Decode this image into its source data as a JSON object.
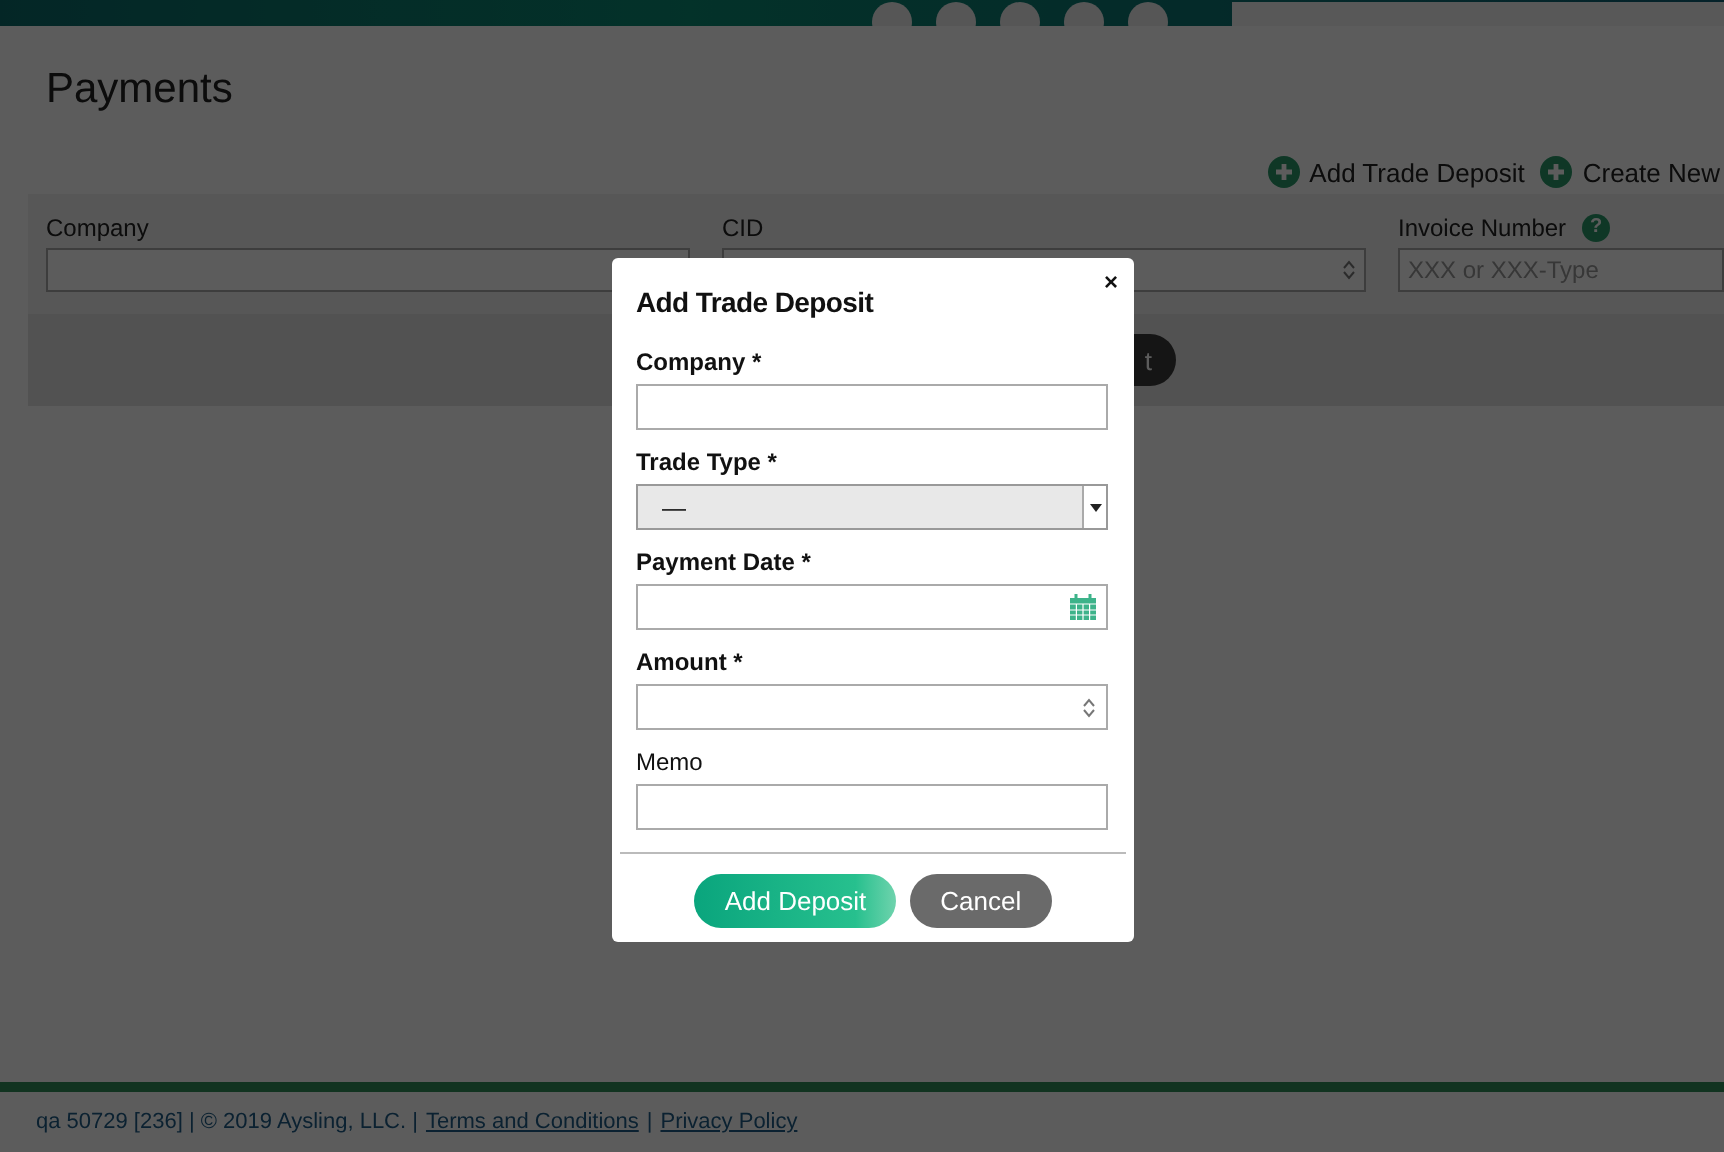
{
  "page": {
    "title": "Payments",
    "actions": [
      {
        "label": "Add Trade Deposit"
      },
      {
        "label": "Create New"
      }
    ],
    "filters": [
      {
        "label": "Company",
        "kind": "text"
      },
      {
        "label": "CID",
        "kind": "number"
      },
      {
        "label": "Invoice Number",
        "kind": "text",
        "help": "?",
        "placeholder": "XXX or XXX-Type"
      }
    ],
    "search_button": "t"
  },
  "modal": {
    "title": "Add Trade Deposit",
    "close": "×",
    "fields": [
      {
        "label": "Company *",
        "kind": "text",
        "required": true
      },
      {
        "label": "Trade Type *",
        "kind": "select",
        "required": true,
        "value": "—"
      },
      {
        "label": "Payment Date *",
        "kind": "date",
        "required": true
      },
      {
        "label": "Amount *",
        "kind": "number",
        "required": true
      },
      {
        "label": "Memo",
        "kind": "text",
        "required": false
      }
    ],
    "buttons": [
      {
        "label": "Add Deposit",
        "kind": "primary"
      },
      {
        "label": "Cancel",
        "kind": "secondary"
      }
    ]
  },
  "footer": {
    "info": "qa 50729 [236] | © 2019 Aysling, LLC. |",
    "links": [
      "Terms and Conditions",
      "Privacy Policy"
    ],
    "separator": "|"
  }
}
